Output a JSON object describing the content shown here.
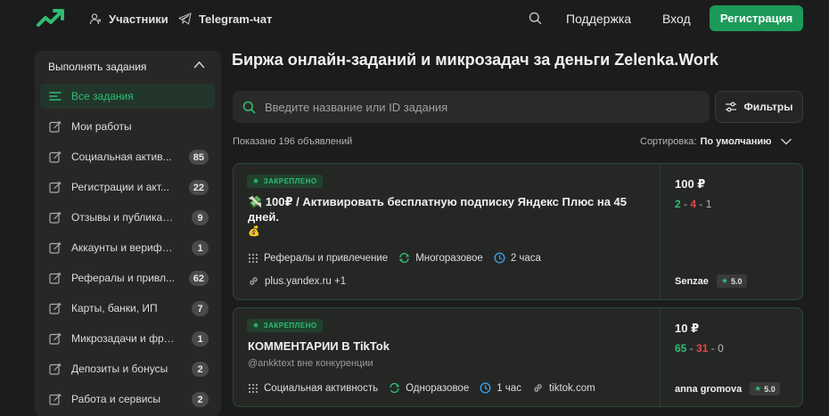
{
  "header": {
    "nav": [
      {
        "label": "Участники",
        "icon": "users-icon"
      },
      {
        "label": "Telegram-чат",
        "icon": "telegram-icon"
      }
    ],
    "support_label": "Поддержка",
    "login_label": "Вход",
    "register_label": "Регистрация"
  },
  "sidebar": {
    "title": "Выполнять задания",
    "items": [
      {
        "label": "Все задания",
        "count": ""
      },
      {
        "label": "Мои работы",
        "count": ""
      },
      {
        "label": "Социальная актив...",
        "count": "85"
      },
      {
        "label": "Регистрации и акт...",
        "count": "22"
      },
      {
        "label": "Отзывы и публикации",
        "count": "9"
      },
      {
        "label": "Аккаунты и верифик...",
        "count": "1"
      },
      {
        "label": "Рефералы и привл...",
        "count": "62"
      },
      {
        "label": "Карты, банки, ИП",
        "count": "7"
      },
      {
        "label": "Микрозадачи и фри...",
        "count": "1"
      },
      {
        "label": "Депозиты и бонусы",
        "count": "2"
      },
      {
        "label": "Работа и сервисы",
        "count": "2"
      }
    ]
  },
  "main": {
    "title": "Биржа онлайн-заданий и микрозадач за деньги Zelenka.Work",
    "search_placeholder": "Введите название или ID задания",
    "filters_label": "Фильтры",
    "shown_text": "Показано 196 объявлений",
    "sort_label": "Сортировка:",
    "sort_value": "По умолчанию",
    "cards": [
      {
        "badge": "ЗАКРЕПЛЕНО",
        "title_line1": "💸 100₽ / Активировать бесплатную подписку Яндекс Плюс на 45",
        "title_line2": "дней.",
        "title_line3": "💰",
        "category": "Рефералы и привлечение",
        "mode": "Многоразовое",
        "time": "2 часа",
        "link": "plus.yandex.ru +1",
        "price": "100 ₽",
        "stat_ok": "2",
        "stat_fail": "4",
        "stat_wait": "1",
        "author": "Senzae",
        "rating": "5.0"
      },
      {
        "badge": "ЗАКРЕПЛЕНО",
        "title_line1": "КОММЕНТАРИИ В TikTok",
        "subtitle": "@ankktext вне конкуренции",
        "category": "Социальная активность",
        "mode": "Одноразовое",
        "time": "1 час",
        "link": "tiktok.com",
        "price": "10 ₽",
        "stat_ok": "65",
        "stat_fail": "31",
        "stat_wait": "0",
        "author": "anna gromova",
        "rating": "5.0"
      }
    ]
  },
  "colors": {
    "accent": "#2fbd72",
    "register": "#1c9a5a",
    "fail": "#e04848"
  }
}
